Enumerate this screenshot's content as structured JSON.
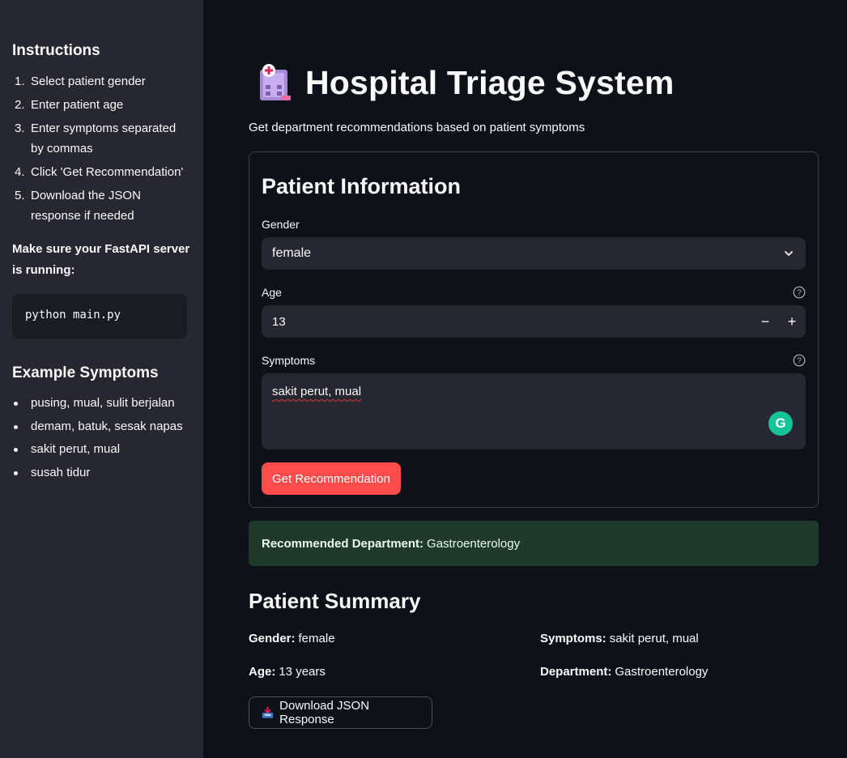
{
  "sidebar": {
    "instructions_title": "Instructions",
    "steps": [
      {
        "num": "1.",
        "text": "Select patient gender"
      },
      {
        "num": "2.",
        "text": "Enter patient age"
      },
      {
        "num": "3.",
        "text": "Enter symptoms separated by commas"
      },
      {
        "num": "4.",
        "text": "Click 'Get Recommendation'"
      },
      {
        "num": "5.",
        "text": "Download the JSON response if needed"
      }
    ],
    "note": "Make sure your FastAPI server is running:",
    "code": "python main.py",
    "examples_title": "Example Symptoms",
    "examples": [
      "pusing, mual, sulit berjalan",
      "demam, batuk, sesak napas",
      "sakit perut, mual",
      "susah tidur"
    ]
  },
  "header": {
    "title": "Hospital Triage System",
    "icon": "hospital-icon",
    "subtitle": "Get department recommendations based on patient symptoms"
  },
  "form": {
    "title": "Patient Information",
    "gender_label": "Gender",
    "gender_value": "female",
    "age_label": "Age",
    "age_value": "13",
    "minus": "−",
    "plus": "+",
    "symptoms_label": "Symptoms",
    "symptoms_value": "sakit perut, mual",
    "submit_label": "Get Recommendation"
  },
  "result": {
    "label": "Recommended Department:",
    "value": "Gastroenterology"
  },
  "summary": {
    "title": "Patient Summary",
    "gender_label": "Gender:",
    "gender_value": "female",
    "age_label": "Age:",
    "age_value": "13 years",
    "symptoms_label": "Symptoms:",
    "symptoms_value": "sakit perut, mual",
    "department_label": "Department:",
    "department_value": "Gastroenterology",
    "download_label": "Download JSON Response"
  },
  "colors": {
    "accent": "#ff4b4b",
    "success_bg": "#1f3a2a",
    "sidebar_bg": "#262730",
    "page_bg": "#0e1117"
  }
}
